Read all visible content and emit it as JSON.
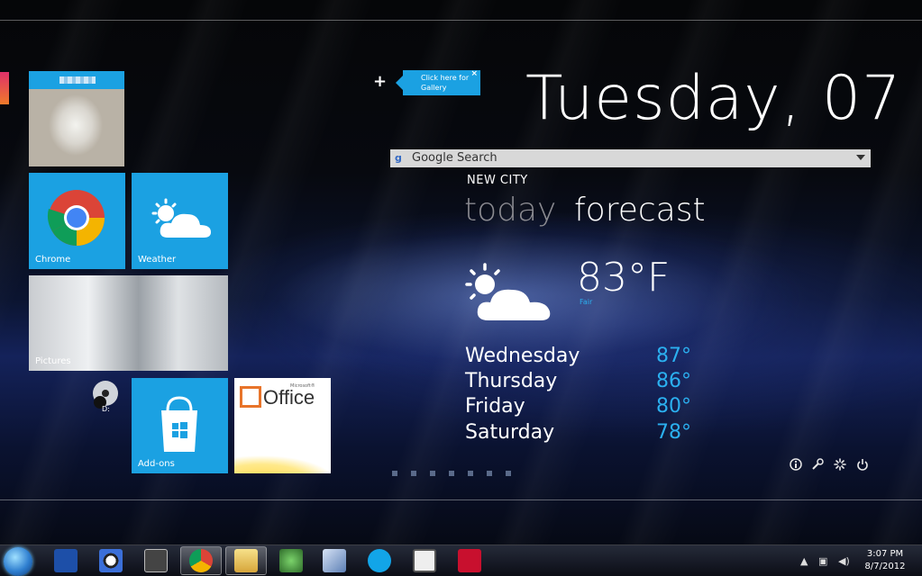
{
  "tiles": {
    "photo": {
      "name_label": ""
    },
    "chrome": {
      "label": "Chrome"
    },
    "weather": {
      "label": "Weather"
    },
    "pictures": {
      "label": "Pictures"
    },
    "addons": {
      "label": "Add-ons"
    },
    "office": {
      "label": "Office",
      "small": "Microsoft®"
    }
  },
  "desktop_icon": {
    "label": "D:"
  },
  "gallery": {
    "plus": "+",
    "hint": "Click here for Gallery",
    "close": "×"
  },
  "date": {
    "text": "Tuesday, 07"
  },
  "search": {
    "label": "Google Search"
  },
  "weather": {
    "city": "NEW CITY",
    "today_label": "today",
    "forecast_label": "forecast",
    "current_temp": "83°F",
    "condition": "Fair",
    "forecast": [
      {
        "day": "Wednesday",
        "temp": "87°"
      },
      {
        "day": "Thursday",
        "temp": "86°"
      },
      {
        "day": "Friday",
        "temp": "80°"
      },
      {
        "day": "Saturday",
        "temp": "78°"
      }
    ]
  },
  "pager": {
    "count": 7
  },
  "controls": [
    "info-icon",
    "settings-wrench-icon",
    "loading-icon",
    "power-icon"
  ],
  "taskbar": {
    "time": "3:07 PM",
    "date": "8/7/2012"
  },
  "colors": {
    "tile_blue": "#1ba1e2",
    "accent_temp": "#2bb0f0"
  }
}
